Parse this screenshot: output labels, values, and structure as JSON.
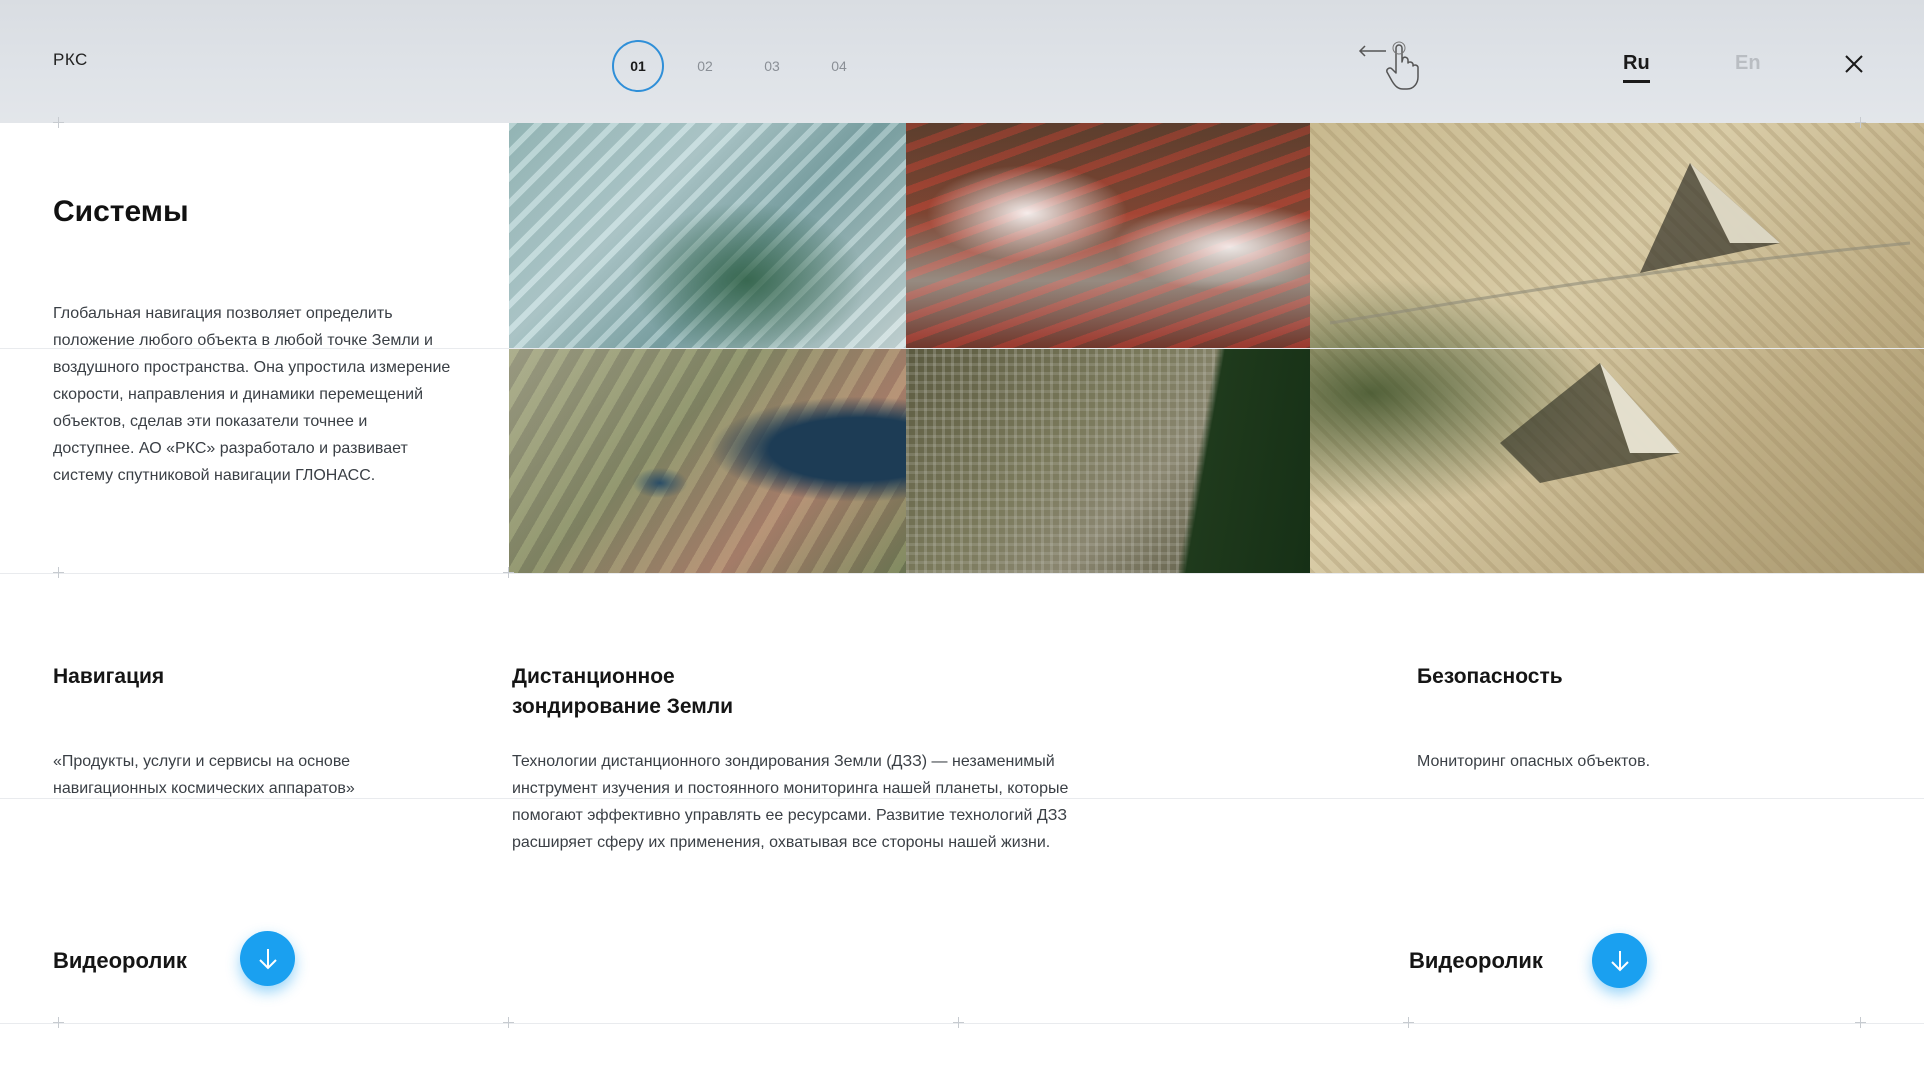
{
  "header": {
    "logo": "РКС",
    "steps": [
      "01",
      "02",
      "03",
      "04"
    ],
    "active_step": "01",
    "lang_ru": "Ru",
    "lang_en": "En",
    "accent": "#2f8fd8"
  },
  "intro": {
    "title": "Системы",
    "text": "Глобальная навигация позволяет определить положение любого объекта в любой точке Земли и воздушного пространства. Она упростила измерение скорости, направления и динамики перемещений объектов, сделав эти показатели точнее и доступнее. АО «РКС» разработало и развивает систему спутниковой навигации ГЛОНАСС."
  },
  "sections": {
    "navigation": {
      "title": "Навигация",
      "text": "«Продукты, услуги и сервисы на основе навигационных космических аппаратов»"
    },
    "remote_sensing": {
      "title_line1": "Дистанционное",
      "title_line2": "зондирование Земли",
      "text": "Технологии дистанционного зондирования Земли (ДЗЗ) — незаменимый инструмент изучения и постоянного мониторинга нашей планеты, которые помогают  эффективно управлять ее ресурсами. Развитие технологий ДЗЗ расширяет сферу их применения, охватывая все стороны нашей жизни."
    },
    "security": {
      "title": "Безопасность",
      "text": "Мониторинг опасных объектов."
    }
  },
  "video": {
    "label_left": "Видеоролик",
    "label_right": "Видеоролик",
    "button_color": "#1aa0f0"
  },
  "icons": {
    "swipe_hint": "swipe-hand-icon",
    "close": "close-icon",
    "download": "arrow-down-icon"
  }
}
